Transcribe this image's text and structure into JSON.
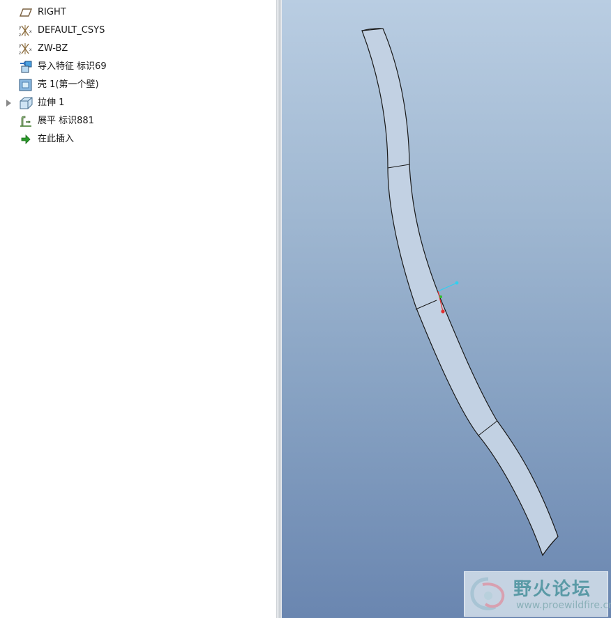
{
  "model_tree": {
    "items": [
      {
        "label": "RIGHT",
        "icon": "datum-plane-icon"
      },
      {
        "label": "DEFAULT_CSYS",
        "icon": "coordinate-system-icon"
      },
      {
        "label": "ZW-BZ",
        "icon": "coordinate-system-icon"
      },
      {
        "label": "导入特征 标识69",
        "icon": "import-feature-icon"
      },
      {
        "label": "壳 1(第一个壁)",
        "icon": "shell-icon"
      },
      {
        "label": "拉伸 1",
        "icon": "extrude-icon",
        "expandable": true
      },
      {
        "label": "展平 标识881",
        "icon": "flatten-icon"
      },
      {
        "label": "在此插入",
        "icon": "insert-here-arrow-icon"
      }
    ]
  },
  "watermark": {
    "title": "野火论坛",
    "url": "www.proewildfire.cn"
  },
  "colors": {
    "viewport_top": "#b9cde2",
    "viewport_bottom": "#6a86b0",
    "part_surface": "#c2d1e3",
    "axis_x": "#e03030",
    "axis_y": "#30c030",
    "axis_z": "#30d0f0"
  }
}
